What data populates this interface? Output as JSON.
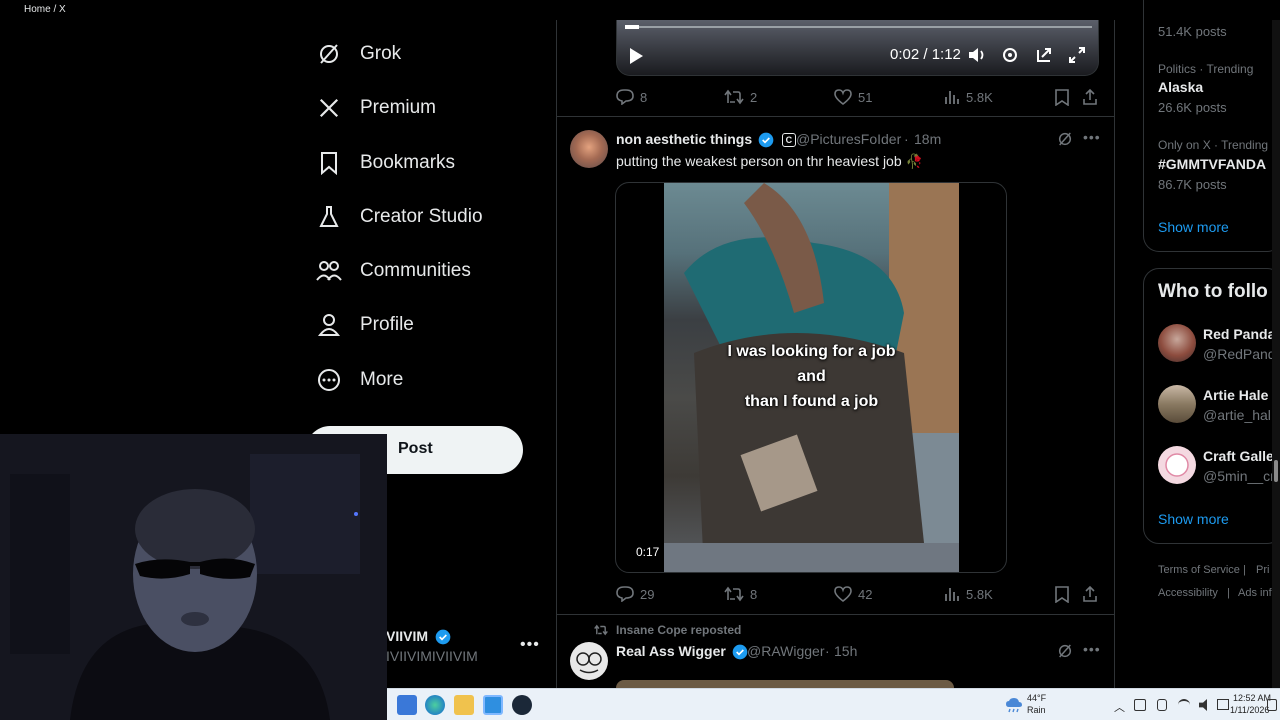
{
  "window": {
    "title": "Home / X",
    "controls": [
      "minimize",
      "maximize",
      "close"
    ]
  },
  "nav": {
    "items": [
      {
        "label": "Grok",
        "icon": "grok-icon"
      },
      {
        "label": "Premium",
        "icon": "x-logo-icon"
      },
      {
        "label": "Bookmarks",
        "icon": "bookmark-icon"
      },
      {
        "label": "Creator Studio",
        "icon": "flask-icon"
      },
      {
        "label": "Communities",
        "icon": "communities-icon"
      },
      {
        "label": "Profile",
        "icon": "person-icon"
      },
      {
        "label": "More",
        "icon": "more-circle-icon"
      }
    ],
    "post_label": "Post",
    "account": {
      "name": "VIIVIM",
      "handle": "IVIIVIMIVIIVIM"
    }
  },
  "tweet1": {
    "video_time": "0:02 / 1:12",
    "progress_fraction": 0.03,
    "replies": "8",
    "reposts": "2",
    "likes": "51",
    "views": "5.8K"
  },
  "tweet2": {
    "name": "non aesthetic things",
    "badge": "C",
    "handle": "@PicturesFoIder",
    "time": "18m",
    "text": "putting the weakest person on thr heaviest job 🥀",
    "caption_lines": [
      "I was looking for a job",
      "and",
      "than I found a job"
    ],
    "duration": "0:17",
    "replies": "29",
    "reposts": "8",
    "likes": "42",
    "views": "5.8K"
  },
  "tweet3": {
    "social_context": "Insane Cope reposted",
    "name": "Real Ass Wigger",
    "handle": "@RAWigger",
    "time": "15h"
  },
  "trends": {
    "top_count": "51.4K posts",
    "items": [
      {
        "category": "Politics · Trending",
        "name": "Alaska",
        "count": "26.6K posts"
      },
      {
        "category": "Only on X · Trending",
        "name": "#GMMTVFANDA",
        "count": "86.7K posts"
      }
    ],
    "show_more": "Show more"
  },
  "who_to_follow": {
    "title": "Who to follo",
    "people": [
      {
        "name": "Red Panda",
        "handle": "@RedPand"
      },
      {
        "name": "Artie Hale",
        "handle": "@artie_hal"
      },
      {
        "name": "Craft Galle",
        "handle": "@5min__cr"
      }
    ],
    "show_more": "Show more"
  },
  "footer": {
    "links": [
      "Terms of Service",
      "|",
      "Pri",
      "Accessibility",
      "|",
      "Ads inf"
    ]
  },
  "taskbar": {
    "weather_temp": "44°F",
    "weather_desc": "Rain",
    "time": "12:52 AM",
    "date": "1/11/2026"
  },
  "colors": {
    "background": "#000000",
    "text": "#e7e9ea",
    "muted": "#71767b",
    "accent": "#1d9bf0",
    "border": "#2f3336"
  }
}
